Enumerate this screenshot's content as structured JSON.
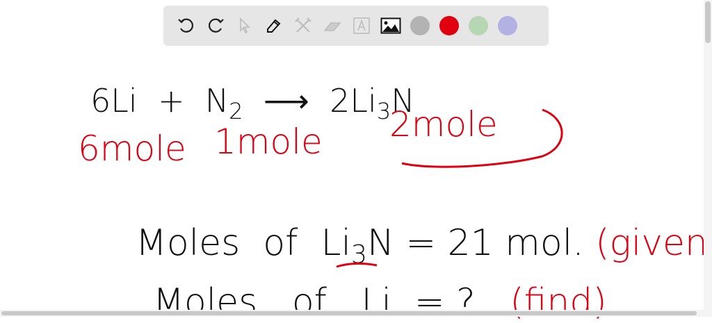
{
  "toolbar": {
    "tools": [
      "undo-icon",
      "redo-icon",
      "select-icon",
      "pen-icon",
      "tools-icon",
      "eraser-icon",
      "text-icon",
      "image-icon"
    ],
    "colors": [
      "#b3b3b3",
      "#e00010",
      "#b7d6b4",
      "#b3b0e3"
    ]
  },
  "board": {
    "equation": {
      "lhs1": "6Li",
      "plus": "+",
      "n": "N",
      "n_sub": "2",
      "arrow": "⟶",
      "coef": "2",
      "li": "Li",
      "li_sub": "3",
      "n2": "N"
    },
    "moles": {
      "m1": "6mole",
      "m2": "1mole",
      "m3": "2mole"
    },
    "line1": {
      "label": "Moles",
      "of": "of",
      "li": "Li",
      "sub": "3",
      "n": "N",
      "eq": "= 21 mol.",
      "note": "(given)"
    },
    "line2": {
      "label": "Moles",
      "of": "of",
      "li": "Li",
      "eq": "= ?",
      "note": "(find)"
    }
  }
}
